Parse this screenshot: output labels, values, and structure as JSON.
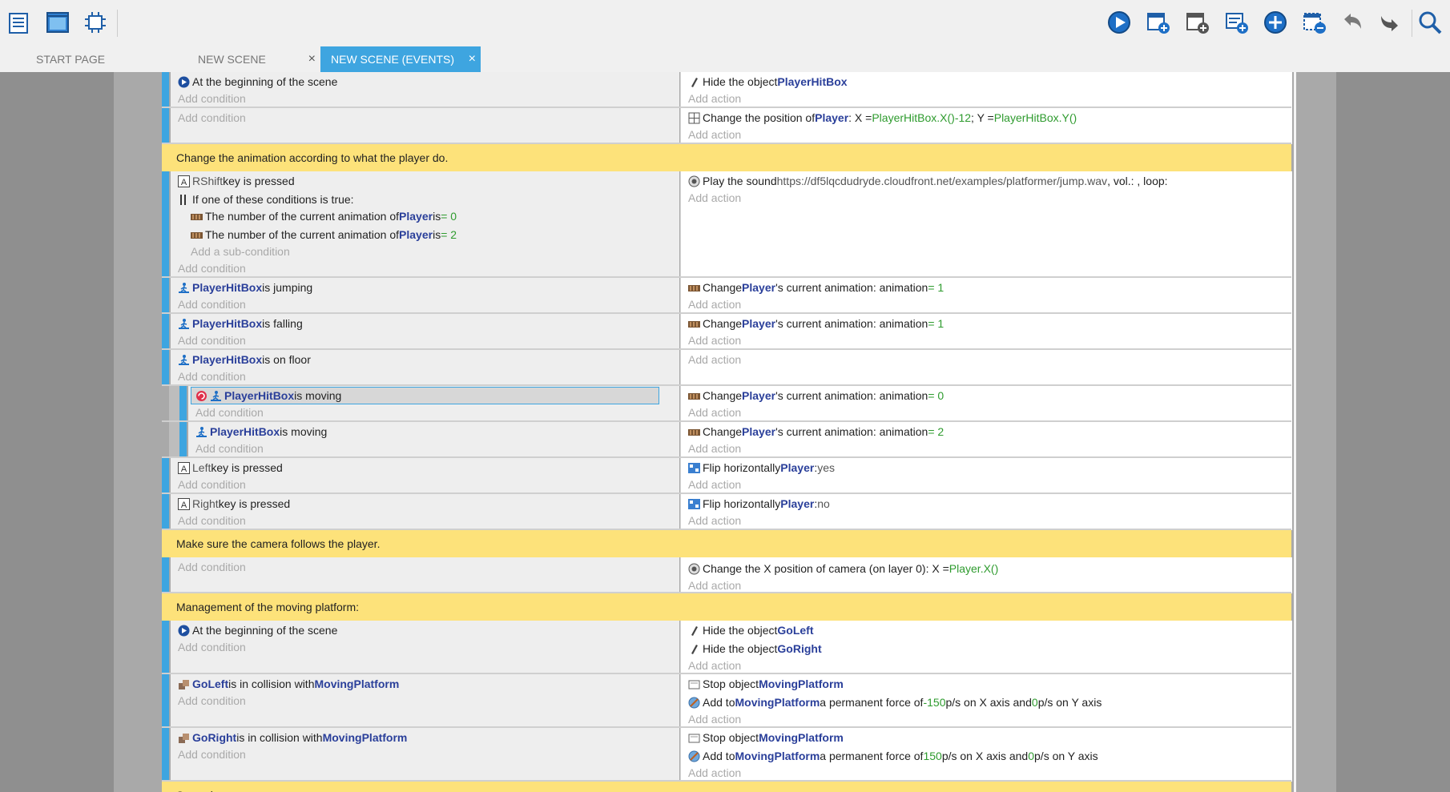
{
  "toolbar": {
    "left_icons": [
      "events-list-icon",
      "scene-editor-icon",
      "extensions-icon"
    ],
    "right_icons": [
      "play-icon",
      "add-event-icon",
      "add-subevent-icon",
      "add-comment-icon",
      "add-more-icon",
      "delete-event-icon",
      "undo-icon",
      "redo-icon",
      "search-icon"
    ]
  },
  "tabs": [
    {
      "label": "START PAGE",
      "active": false
    },
    {
      "label": "NEW SCENE",
      "active": false,
      "close": "×"
    },
    {
      "label": "NEW SCENE (EVENTS)",
      "active": true,
      "close": "×"
    }
  ],
  "placeholders": {
    "add_condition": "Add condition",
    "add_action": "Add action",
    "add_subcondition": "Add a sub-condition"
  },
  "events": {
    "e1": {
      "cond1": "At the beginning of the scene",
      "act1_pre": "Hide the object ",
      "act1_obj": "PlayerHitBox"
    },
    "e2": {
      "act1_pre": "Change the position of ",
      "act1_obj": "Player",
      "act1_mid": ": X  = ",
      "act1_v1": " PlayerHitBox.X()-12",
      "act1_sep": "; Y  = ",
      "act1_v2": " PlayerHitBox.Y()"
    },
    "c1": {
      "text": "Change the animation according to what the player do."
    },
    "e3": {
      "key": "RShift",
      "key_suffix": " key is pressed",
      "or": "If one of these conditions is true:",
      "sub1_pre": "The number of the current animation of ",
      "sub1_obj": "Player",
      "sub1_mid": " is ",
      "sub1_val": " = 0",
      "sub2_pre": "The number of the current animation of ",
      "sub2_obj": "Player",
      "sub2_mid": " is ",
      "sub2_val": " = 2",
      "act_pre": "Play the sound ",
      "act_url": "https://df5lqcdudryde.cloudfront.net/examples/platformer/jump.wav",
      "act_tail": ", vol.: , loop:"
    },
    "e4": {
      "obj": "PlayerHitBox",
      "cond": " is jumping",
      "act_pre": "Change ",
      "act_obj": "Player",
      "act_mid": "'s current animation: animation ",
      "act_val": " =  1"
    },
    "e5": {
      "obj": "PlayerHitBox",
      "cond": " is falling",
      "act_pre": "Change ",
      "act_obj": "Player",
      "act_mid": "'s current animation: animation ",
      "act_val": " =  1"
    },
    "e6": {
      "obj": "PlayerHitBox",
      "cond": " is on floor"
    },
    "e7": {
      "obj": "PlayerHitBox",
      "cond": " is moving",
      "act_pre": "Change ",
      "act_obj": "Player",
      "act_mid": "'s current animation: animation ",
      "act_val": " =  0"
    },
    "e8": {
      "obj": "PlayerHitBox",
      "cond": " is moving",
      "act_pre": "Change ",
      "act_obj": "Player",
      "act_mid": "'s current animation: animation ",
      "act_val": " =  2"
    },
    "e9": {
      "key": "Left",
      "key_suffix": " key is pressed",
      "act_pre": "Flip horizontally ",
      "act_obj": "Player",
      "act_mid": " : ",
      "act_val": "yes"
    },
    "e10": {
      "key": "Right",
      "key_suffix": " key is pressed",
      "act_pre": "Flip horizontally ",
      "act_obj": "Player",
      "act_mid": " : ",
      "act_val": "no"
    },
    "c2": {
      "text": "Make sure the camera follows the player."
    },
    "e11": {
      "act_pre": "Change the X position of camera  (on layer 0): X  = ",
      "act_val": " Player.X()"
    },
    "c3": {
      "text": "Management of the moving platform:"
    },
    "e12": {
      "cond": "At the beginning of the scene",
      "act1_pre": "Hide the object ",
      "act1_obj": "GoLeft",
      "act2_pre": "Hide the object ",
      "act2_obj": "GoRight"
    },
    "e13": {
      "obj": "GoLeft",
      "mid": " is in collision with ",
      "obj2": "MovingPlatform",
      "act1_pre": "Stop object ",
      "act1_obj": "MovingPlatform",
      "act2_pre": "Add to ",
      "act2_obj": "MovingPlatform",
      "act2_mid": "  a permanent  force of ",
      "act2_v1": "-150",
      "act2_m2": " p/s on X axis and ",
      "act2_v2": "0",
      "act2_m3": " p/s on Y axis"
    },
    "e14": {
      "obj": "GoRight",
      "mid": " is in collision with ",
      "obj2": "MovingPlatform",
      "act1_pre": "Stop object ",
      "act1_obj": "MovingPlatform",
      "act2_pre": "Add to ",
      "act2_obj": "MovingPlatform",
      "act2_mid": "  a permanent  force of ",
      "act2_v1": "150",
      "act2_m2": " p/s on X axis and ",
      "act2_v2": "0",
      "act2_m3": " p/s on Y axis"
    },
    "c4": {
      "text": "Spawning..."
    }
  },
  "colors": {
    "accent": "#3ea5e0",
    "comment": "#fde27a",
    "object": "#2a3f9a",
    "value": "#2e9b2e",
    "placeholder": "#a9a9a9"
  }
}
